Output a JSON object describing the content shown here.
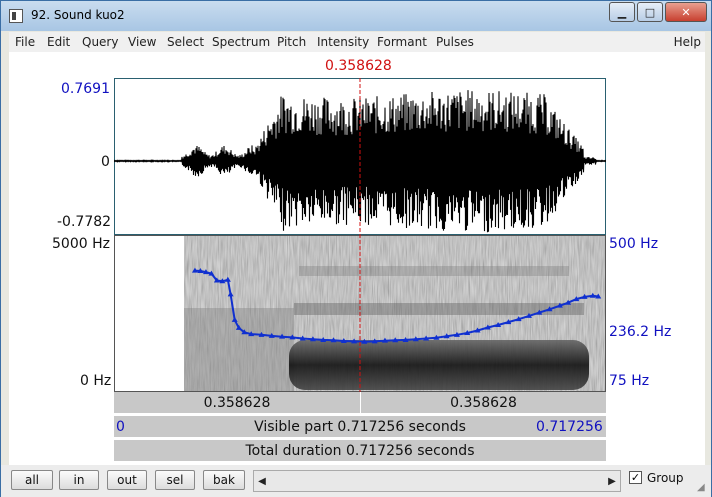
{
  "window": {
    "title": "92. Sound kuo2",
    "minimize": "▁",
    "maximize": "□",
    "close": "✕"
  },
  "menu": [
    "File",
    "Edit",
    "Query",
    "View",
    "Select",
    "Spectrum",
    "Pitch",
    "Intensity",
    "Formant",
    "Pulses"
  ],
  "menu_help": "Help",
  "cursor": {
    "time_label": "0.358628",
    "time": 0.358628,
    "total": 0.717256
  },
  "waveform": {
    "max_label": "0.7691",
    "zero_label": "0",
    "min_label": "-0.7782"
  },
  "spectrogram": {
    "top_label": "5000 Hz",
    "bottom_label": "0 Hz"
  },
  "pitch": {
    "top_label": "500 Hz",
    "mid_label": "236.2 Hz",
    "bottom_label": "75 Hz",
    "range_hz": [
      75,
      500
    ],
    "contour_hz": [
      [
        0.118,
        405
      ],
      [
        0.126,
        404
      ],
      [
        0.134,
        401
      ],
      [
        0.142,
        397
      ],
      [
        0.15,
        378
      ],
      [
        0.158,
        376
      ],
      [
        0.166,
        380
      ],
      [
        0.17,
        340
      ],
      [
        0.176,
        270
      ],
      [
        0.182,
        248
      ],
      [
        0.19,
        236
      ],
      [
        0.2,
        231
      ],
      [
        0.215,
        229
      ],
      [
        0.23,
        226
      ],
      [
        0.245,
        224
      ],
      [
        0.26,
        222
      ],
      [
        0.275,
        219
      ],
      [
        0.29,
        217
      ],
      [
        0.305,
        215
      ],
      [
        0.32,
        214
      ],
      [
        0.335,
        212
      ],
      [
        0.35,
        211
      ],
      [
        0.365,
        210
      ],
      [
        0.38,
        211
      ],
      [
        0.395,
        213
      ],
      [
        0.41,
        214
      ],
      [
        0.425,
        215
      ],
      [
        0.44,
        217
      ],
      [
        0.455,
        219
      ],
      [
        0.47,
        221
      ],
      [
        0.485,
        225
      ],
      [
        0.5,
        229
      ],
      [
        0.515,
        234
      ],
      [
        0.53,
        241
      ],
      [
        0.545,
        249
      ],
      [
        0.56,
        256
      ],
      [
        0.575,
        264
      ],
      [
        0.59,
        272
      ],
      [
        0.605,
        281
      ],
      [
        0.62,
        290
      ],
      [
        0.635,
        299
      ],
      [
        0.65,
        309
      ],
      [
        0.662,
        317
      ],
      [
        0.674,
        327
      ],
      [
        0.686,
        333
      ],
      [
        0.698,
        336
      ],
      [
        0.706,
        334
      ]
    ]
  },
  "selection_bar": {
    "left": "0.358628",
    "right": "0.358628"
  },
  "visible_bar": {
    "start": "0",
    "label": "Visible part 0.717256 seconds",
    "end": "0.717256"
  },
  "total_bar": {
    "label": "Total duration 0.717256 seconds"
  },
  "buttons": {
    "all": "all",
    "in": "in",
    "out": "out",
    "sel": "sel",
    "bak": "bak"
  },
  "group": {
    "label": "Group",
    "checked": "✓"
  },
  "colors": {
    "cursor": "#d01010",
    "pitch": "#1030d0",
    "axis_blue": "#1010c0"
  }
}
